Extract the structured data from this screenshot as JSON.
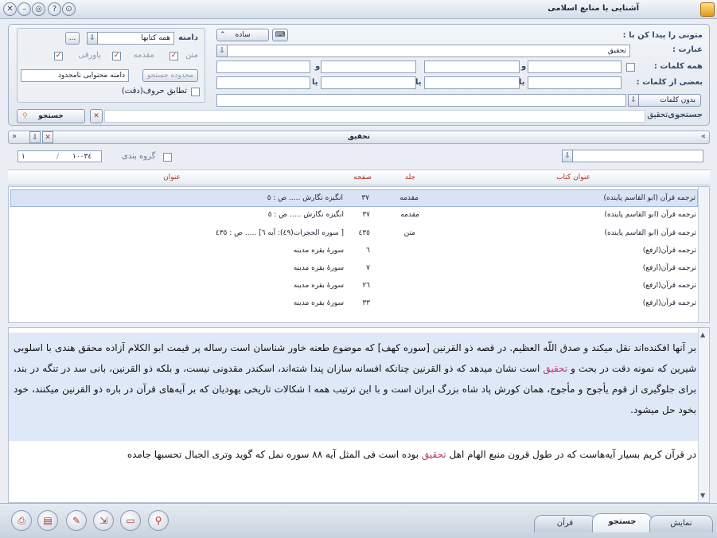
{
  "window": {
    "title": "آشنایی با منابع اسلامی"
  },
  "search": {
    "search_for_label": "متونی را پیدا کن با :",
    "phrase_label": "عبارت :",
    "phrase_value": "تحقیق",
    "all_words_label": "همه کلمات :",
    "some_words_label": "بعضی از کلمات :",
    "without_words_label": "بدون کلمات",
    "and_label": "و",
    "or_label": "یا",
    "mode_value": "ساده",
    "domain_label": "دامنه",
    "domain_value": "همه کتابها",
    "ellipsis_label": "...",
    "filter_text": "متن",
    "filter_intro": "مقدمه",
    "filter_footnote": "پاورقی",
    "range_button": "محدوده جستجو",
    "range_value": "دامنه محتوایی نامحدود",
    "exact_match_label": "تطابق حروف(دقت)",
    "search_button": "جستجو",
    "searched_label": "جستجوی",
    "searched_value": "تحقیق"
  },
  "results_bar": {
    "title": "تحقیق",
    "group_label": "گروه بندی",
    "count_value": "١٠٠٣٤",
    "page_value": "١"
  },
  "columns": {
    "book": "عنوان کتاب",
    "volume": "جلد",
    "page": "صفحه",
    "title": "عنوان"
  },
  "results": [
    {
      "book": "ترجمه قرآن (ابو القاسم پاینده)",
      "volume": "مقدمه",
      "page": "٣٧",
      "title": "انگیزه نگارش ..... ص : ٥"
    },
    {
      "book": "ترجمه قرآن (ابو القاسم پاینده)",
      "volume": "مقدمه",
      "page": "٣٧",
      "title": "انگیزه نگارش ..... ص : ٥"
    },
    {
      "book": "ترجمه قرآن (ابو القاسم پاینده)",
      "volume": "متن",
      "page": "٤٣٥",
      "title": "[ سوره الحجرات(٤٩): آیه ٦] ..... ص : ٤٣٥"
    },
    {
      "book": "ترجمه قرآن(ارفع)",
      "volume": "",
      "page": "٦",
      "title": "سورهٔ بقره مدینه"
    },
    {
      "book": "ترجمه قرآن(ارفع)",
      "volume": "",
      "page": "٧",
      "title": "سورهٔ بقره مدینه"
    },
    {
      "book": "ترجمه قرآن(ارفع)",
      "volume": "",
      "page": "٢٦",
      "title": "سورهٔ بقره مدینه"
    },
    {
      "book": "ترجمه قرآن(ارفع)",
      "volume": "",
      "page": "٣٣",
      "title": "سورهٔ بقره مدینه"
    }
  ],
  "preview": {
    "p1_before": "بر آنها افکنده‌اند نقل میکند و صدق اللّه العظیم. در قصه ذو القرنین [سوره کهف] که موضوع طعنه خاور شناسان است رساله پر قیمت ابو الکلام آزاده محقق هندی با اسلوبی شیرین که نمونه دقت در بحث و",
    "p1_highlight": "تحقیق",
    "p1_after": "است نشان میدهد که ذو القرنین چنانکه افسانه سازان پندا شته‌اند، اسکندر مقدونی نیست، و بلکه ذو القرنین، بانی سد در تنگه در بند، برای جلوگیری از قوم یأجوج و مأجوج، همان کورش پاد شاه بزرگ ایران است و با این ترتیب همه ا شکالات تاریخی یهودیان که بر آیه‌های قرآن در باره ذو القرنین میکنند، خود بخود حل میشود.",
    "p2_before": "در قرآن کریم بسیار آیه‌هاست که در طول قرون منبع الهام اهل",
    "p2_highlight": "تحقیق",
    "p2_after": "بوده است فی المثل آیه ٨٨ سوره نمل که گوید وتری الجبال تحسبها جامده"
  },
  "tabs": {
    "display": "نمایش",
    "search": "جستجو",
    "quran": "قرآن"
  },
  "colors": {
    "accent": "#c0326f",
    "header_text": "#b0311f",
    "selection": "#d8e4f6"
  }
}
